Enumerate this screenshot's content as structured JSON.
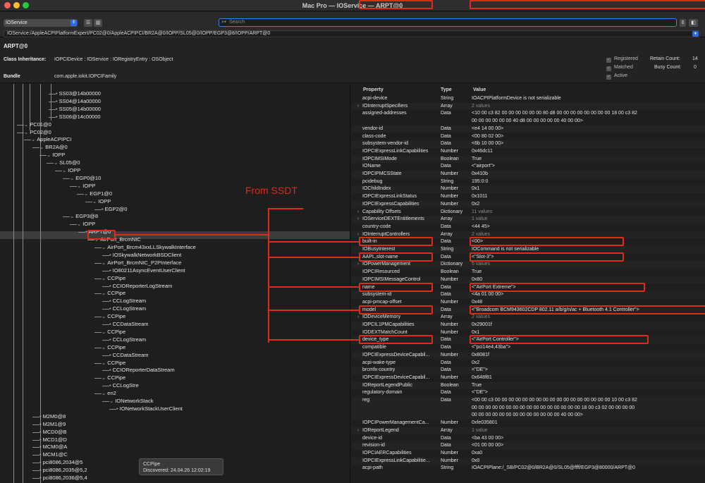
{
  "window": {
    "title": "Mac Pro — IOService — ARPT@0"
  },
  "toolbar": {
    "plane": "IOService",
    "search_placeholder": "Search",
    "path": "IOService:/AppleACPIPlatformExpert/PC02@0/AppleACPIPCI/BR2A@0/IOPP/SL05@0/IOPP/EGP3@8/IOPP/ARPT@0"
  },
  "info": {
    "name": "ARPT@0",
    "class_label": "Class Inheritance:",
    "class_value": "IOPCIDevice : IOService : IORegistryEntry : OSObject",
    "bundle_label": "Bundle",
    "bundle_value": "com.apple.iokit.IOPCIFamily",
    "registered": "Registered",
    "matched": "Matched",
    "active": "Active",
    "retain_label": "Retain Count:",
    "retain_value": "14",
    "busy_label": "Busy Count:",
    "busy_value": "0"
  },
  "tree": [
    {
      "t": "SS03@14b00000"
    },
    {
      "t": "SS04@14a00000"
    },
    {
      "t": "SS05@14b00000"
    },
    {
      "t": "SS06@14c00000"
    },
    {
      "t": "PC01@0"
    },
    {
      "t": "PC02@0"
    },
    {
      "t": "AppleACPIPCI"
    },
    {
      "t": "BR2A@0"
    },
    {
      "t": "IOPP"
    },
    {
      "t": "SL05@0"
    },
    {
      "t": "IOPP"
    },
    {
      "t": "EGP0@10"
    },
    {
      "t": "IOPP"
    },
    {
      "t": "EGP1@0"
    },
    {
      "t": "IOPP"
    },
    {
      "t": "EGP2@0"
    },
    {
      "t": "EGP3@8"
    },
    {
      "t": "IOPP"
    },
    {
      "t": "ARPT@0"
    },
    {
      "t": "AirPort_BrcmNIC"
    },
    {
      "t": "AirPort_Brcm43xxLLSkywalkInterface"
    },
    {
      "t": "IOSkywalkNetworkBSDClient"
    },
    {
      "t": "AirPort_BrcmNIC_P2PInterface"
    },
    {
      "t": "IO80211AsyncEventUserClient"
    },
    {
      "t": "CCPipe"
    },
    {
      "t": "CCIOReporterLogStream"
    },
    {
      "t": "CCPipe"
    },
    {
      "t": "CCLogStream"
    },
    {
      "t": "CCLogStream"
    },
    {
      "t": "CCPipe"
    },
    {
      "t": "CCDataStream"
    },
    {
      "t": "CCPipe"
    },
    {
      "t": "CCLogStream"
    },
    {
      "t": "CCPipe"
    },
    {
      "t": "CCDataStream"
    },
    {
      "t": "CCPipe"
    },
    {
      "t": "CCIOReporterDataStream"
    },
    {
      "t": "CCPipe"
    },
    {
      "t": "CCLogStre"
    },
    {
      "t": "en2"
    },
    {
      "t": "IONetworkStack"
    },
    {
      "t": "IONetworkStackUserClient"
    },
    {
      "t": "M2M0@8"
    },
    {
      "t": "M2M1@9"
    },
    {
      "t": "MCD0@B"
    },
    {
      "t": "MCD1@D"
    },
    {
      "t": "MCM0@A"
    },
    {
      "t": "MCM1@C"
    },
    {
      "t": "pci8086,2034@5"
    },
    {
      "t": "pci8086,2035@5,2"
    },
    {
      "t": "pci8086,2036@5,4"
    }
  ],
  "tooltip": {
    "line1": "CCPipe",
    "line2": "Discovered: 24.04.26 12:02:19"
  },
  "annotation": "From SSDT",
  "table": {
    "h_prop": "Property",
    "h_type": "Type",
    "h_value": "Value",
    "rows": [
      {
        "p": "acpi-device",
        "t": "String",
        "v": "IOACPIPlatformDevice is not serializable"
      },
      {
        "p": "IOInterruptSpecifiers",
        "t": "Array",
        "v": "2 values",
        "g": 1,
        "d": 1
      },
      {
        "p": "assigned-addresses",
        "t": "Data",
        "v": "<10 00 c3 82 00 00 00 00 00 00 80 d8 00 00 00 00 00 00 00 00 18 00 c3 82",
        "v2": "00 00 00 00 00 00 40 d8 00 00 00 00 00 40 00 00>"
      },
      {
        "p": "vendor-id",
        "t": "Data",
        "v": "<e4 14 00 00>"
      },
      {
        "p": "class-code",
        "t": "Data",
        "v": "<00 80 02 00>"
      },
      {
        "p": "subsystem-vendor-id",
        "t": "Data",
        "v": "<6b 10 00 00>"
      },
      {
        "p": "IOPCIExpressLinkCapabilities",
        "t": "Number",
        "v": "0x46dc11"
      },
      {
        "p": "IOPCIMSIMode",
        "t": "Boolean",
        "v": "True"
      },
      {
        "p": "IOName",
        "t": "Data",
        "v": "<\"airport\">"
      },
      {
        "p": "IOPCIPMCSState",
        "t": "Number",
        "v": "0x410b"
      },
      {
        "p": "pcidebug",
        "t": "String",
        "v": "195:0:0"
      },
      {
        "p": "IOChildIndex",
        "t": "Number",
        "v": "0x1"
      },
      {
        "p": "IOPCIExpressLinkStatus",
        "t": "Number",
        "v": "0x1011"
      },
      {
        "p": "IOPCIExpressCapabilities",
        "t": "Number",
        "v": "0x2"
      },
      {
        "p": "Capability Offsets",
        "t": "Dictionary",
        "v": "11 values",
        "g": 1,
        "d": 1
      },
      {
        "p": "IOServiceDEXTEntitlements",
        "t": "Array",
        "v": "1 value",
        "g": 1,
        "d": 1
      },
      {
        "p": "country-code",
        "t": "Data",
        "v": "<44 45>"
      },
      {
        "p": "IOInterruptControllers",
        "t": "Array",
        "v": "2 values",
        "g": 1,
        "d": 1
      },
      {
        "p": "built-in",
        "t": "Data",
        "v": "<00>"
      },
      {
        "p": "IOBusyInterest",
        "t": "String",
        "v": "IOCommand is not serializable"
      },
      {
        "p": "AAPL,slot-name",
        "t": "Data",
        "v": "<\"Slot-3\">"
      },
      {
        "p": "IOPowerManagement",
        "t": "Dictionary",
        "v": "5 values",
        "g": 1,
        "d": 1
      },
      {
        "p": "IOPCIResourced",
        "t": "Boolean",
        "v": "True"
      },
      {
        "p": "IOPCIMSIMessageControl",
        "t": "Number",
        "v": "0x80"
      },
      {
        "p": "name",
        "t": "Data",
        "v": "<\"AirPort Extreme\">"
      },
      {
        "p": "subsystem-id",
        "t": "Data",
        "v": "<4a 01 00 00>"
      },
      {
        "p": "acpi-pmcap-offset",
        "t": "Number",
        "v": "0x48"
      },
      {
        "p": "model",
        "t": "Data",
        "v": "<\"Broadcom BCM943602CDP 802.11 a/b/g/n/ac + Bluetooth 4.1 Controller\">"
      },
      {
        "p": "IODeviceMemory",
        "t": "Array",
        "v": "2 values",
        "g": 1,
        "d": 1
      },
      {
        "p": "IOPCIL1PMCapabilities",
        "t": "Number",
        "v": "0x29001f"
      },
      {
        "p": "IODEXTMatchCount",
        "t": "Number",
        "v": "0x1"
      },
      {
        "p": "device_type",
        "t": "Data",
        "v": "<\"AirPort Controller\">"
      },
      {
        "p": "compatible",
        "t": "Data",
        "v": "<\"pci14e4,43ba\">"
      },
      {
        "p": "IOPCIExpressDeviceCapabil...",
        "t": "Number",
        "v": "0x8081f"
      },
      {
        "p": "acpi-wake-type",
        "t": "Data",
        "v": "0x2"
      },
      {
        "p": "brcmfx-country",
        "t": "Data",
        "v": "<\"DE\">"
      },
      {
        "p": "IOPCIExpressDeviceCapabil...",
        "t": "Number",
        "v": "0x648f81"
      },
      {
        "p": "IOReportLegendPublic",
        "t": "Boolean",
        "v": "True"
      },
      {
        "p": "regulatory-domain",
        "t": "Data",
        "v": "<\"DE\">"
      },
      {
        "p": "reg",
        "t": "Data",
        "v": "<00 00 c3 00 00 00 00 00 00 00 00 00 00 00 00 00 00 00 00 00 10 00 c3 82",
        "v2": "00 00 00 00 00 00 00 00 00 00 00 00 00 00 00 00 18 00 c3 02 00 00 00 00",
        "v3": "00 00 00 00 00 00 00 00 00 00 00 00 00 40 00 00>"
      },
      {
        "p": "IOPCIPowerManagementCa...",
        "t": "Number",
        "v": "0xfe035801"
      },
      {
        "p": "IOReportLegend",
        "t": "Array",
        "v": "1 value",
        "g": 1,
        "d": 1
      },
      {
        "p": "device-id",
        "t": "Data",
        "v": "<ba 43 00 00>"
      },
      {
        "p": "revision-id",
        "t": "Data",
        "v": "<01 00 00 00>"
      },
      {
        "p": "IOPCIAERCapabilities",
        "t": "Number",
        "v": "0xa0"
      },
      {
        "p": "IOPCIExpressLinkCapabilitie...",
        "t": "Number",
        "v": "0x0"
      },
      {
        "p": "acpi-path",
        "t": "String",
        "v": "IOACPIPlane:/_SB/PC02@0/BR2A@0/SL05@ffff/EGP3@80000/ARPT@0"
      }
    ]
  }
}
